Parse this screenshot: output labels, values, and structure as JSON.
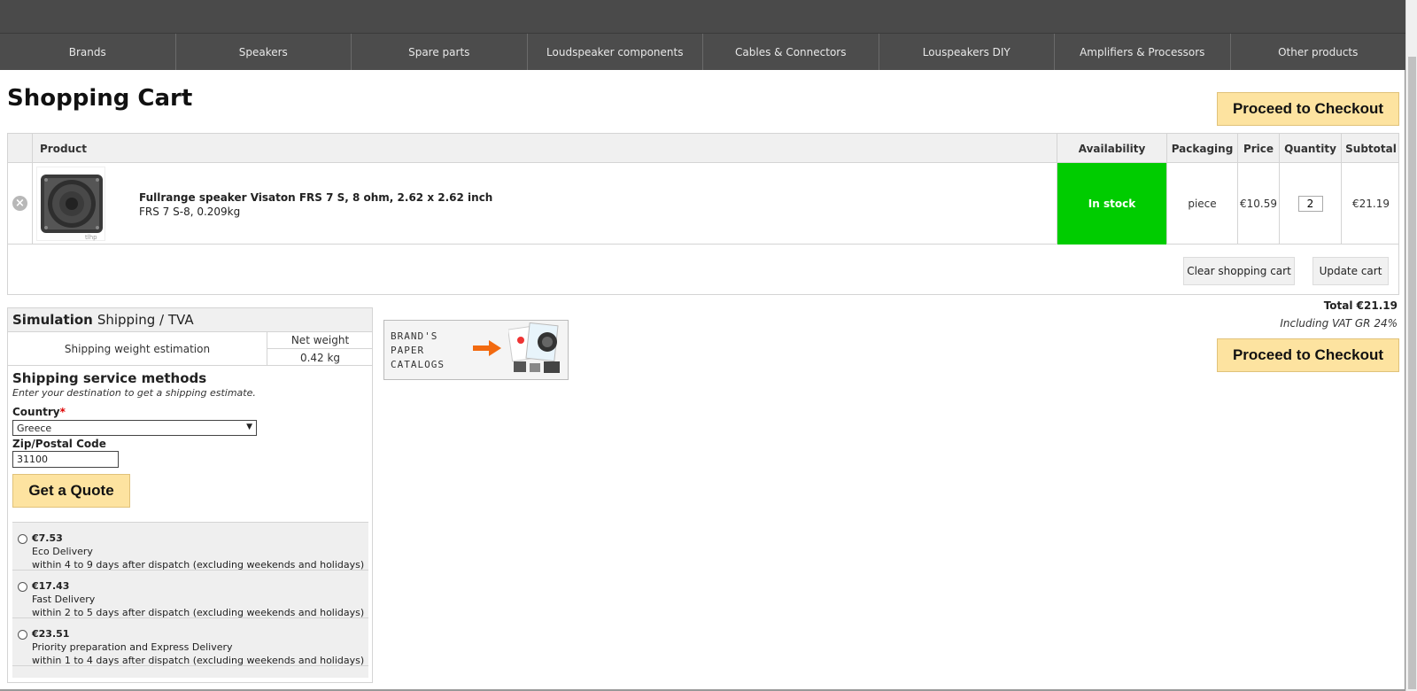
{
  "nav": [
    "Brands",
    "Speakers",
    "Spare parts",
    "Loudspeaker components",
    "Cables & Connectors",
    "Louspeakers DIY",
    "Amplifiers & Processors",
    "Other products"
  ],
  "page": {
    "title": "Shopping Cart",
    "checkout_label": "Proceed to Checkout"
  },
  "cart": {
    "headers": {
      "product": "Product",
      "availability": "Availability",
      "packaging": "Packaging",
      "price": "Price",
      "quantity": "Quantity",
      "subtotal": "Subtotal"
    },
    "item": {
      "name": "Fullrange speaker Visaton FRS 7 S, 8 ohm, 2.62 x 2.62 inch",
      "sku": "FRS 7 S-8, 0.209kg",
      "availability": "In stock",
      "packaging": "piece",
      "price": "€10.59",
      "quantity": "2",
      "subtotal": "€21.19",
      "thumb_mark": "tlhp"
    },
    "clear_label": "Clear shopping cart",
    "update_label": "Update cart"
  },
  "totals": {
    "total": "Total €21.19",
    "vat": "Including VAT GR 24%"
  },
  "shipping": {
    "title_bold": "Simulation",
    "title_rest": "Shipping / TVA",
    "weight_label": "Shipping weight estimation",
    "net_weight_label": "Net weight",
    "net_weight_value": "0.42 kg",
    "methods_title": "Shipping service methods",
    "methods_hint": "Enter your destination to get a shipping estimate.",
    "country_label": "Country",
    "required_mark": "*",
    "country_value": "Greece",
    "zip_label": "Zip/Postal Code",
    "zip_value": "31100",
    "quote_label": "Get a Quote",
    "rates": [
      {
        "price": "€7.53",
        "name": "Eco Delivery",
        "desc": "within 4 to 9 days after dispatch (excluding weekends and holidays)"
      },
      {
        "price": "€17.43",
        "name": "Fast Delivery",
        "desc": "within 2 to 5 days after dispatch (excluding weekends and holidays)"
      },
      {
        "price": "€23.51",
        "name": "Priority preparation and Express Delivery",
        "desc": "within 1 to 4 days after dispatch (excluding weekends and holidays)"
      }
    ]
  },
  "catalog": {
    "line1": "BRAND'S",
    "line2": "PAPER",
    "line3": "CATALOGS"
  },
  "colors": {
    "nav_bg": "#4c4c4c",
    "in_stock": "#00cc00",
    "button_yellow": "#fde3a0",
    "arrow": "#f26a10"
  }
}
